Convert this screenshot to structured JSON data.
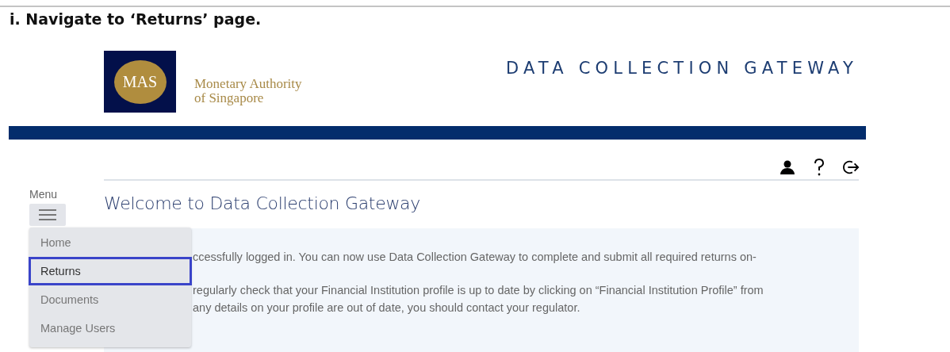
{
  "instruction": "i. Navigate to ‘Returns’ page.",
  "logo": {
    "badge": "MAS",
    "name_lines": [
      "Monetary Authority",
      "of Singapore"
    ]
  },
  "app_title": "DATA COLLECTION GATEWAY",
  "toolbar_icons": [
    {
      "kind": "user"
    },
    {
      "kind": "help"
    },
    {
      "kind": "logout"
    }
  ],
  "menu": {
    "label": "Menu",
    "expanded": true,
    "items": [
      {
        "label": "Home",
        "selected": false
      },
      {
        "label": "Returns",
        "selected": true
      },
      {
        "label": "Documents",
        "selected": false
      },
      {
        "label": "Manage Users",
        "selected": false
      }
    ]
  },
  "page_title": "Welcome to Data Collection Gateway",
  "paragraphs": [
    [
      "ccessfully logged in. You can now use Data Collection Gateway to complete and submit all required returns on-"
    ],
    [
      "regularly check that your Financial Institution profile is up to date by clicking on “Financial Institution Profile” from",
      "any details on your profile are out of date, you should contact your regulator."
    ]
  ]
}
